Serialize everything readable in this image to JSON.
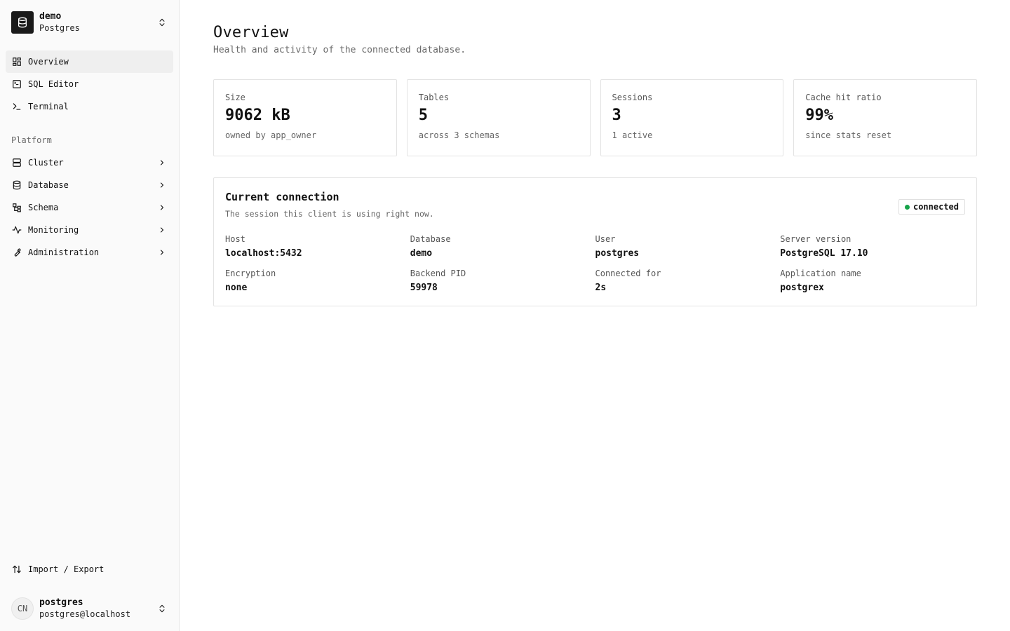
{
  "sidebar": {
    "db_name": "demo",
    "db_type": "Postgres",
    "nav_primary": [
      {
        "label": "Overview",
        "icon": "layout-grid-icon",
        "active": true
      },
      {
        "label": "SQL Editor",
        "icon": "square-terminal-icon"
      },
      {
        "label": "Terminal",
        "icon": "terminal-prompt-icon"
      }
    ],
    "section_label": "Platform",
    "nav_platform": [
      {
        "label": "Cluster",
        "icon": "server-icon"
      },
      {
        "label": "Database",
        "icon": "database-icon"
      },
      {
        "label": "Schema",
        "icon": "schema-tree-icon"
      },
      {
        "label": "Monitoring",
        "icon": "activity-icon"
      },
      {
        "label": "Administration",
        "icon": "wrench-icon"
      }
    ],
    "import_export": "Import / Export",
    "user": {
      "initials": "CN",
      "name": "postgres",
      "email": "postgres@localhost"
    }
  },
  "main": {
    "title": "Overview",
    "subtitle": "Health and activity of the connected database.",
    "stats": [
      {
        "label": "Size",
        "value": "9062 kB",
        "sub": "owned by app_owner"
      },
      {
        "label": "Tables",
        "value": "5",
        "sub": "across 3 schemas"
      },
      {
        "label": "Sessions",
        "value": "3",
        "sub": "1 active"
      },
      {
        "label": "Cache hit ratio",
        "value": "99%",
        "sub": "since stats reset"
      }
    ],
    "connection": {
      "title": "Current connection",
      "subtitle": "The session this client is using right now.",
      "status": "connected",
      "status_color": "#16a34a",
      "fields": [
        {
          "label": "Host",
          "value": "localhost:5432"
        },
        {
          "label": "Database",
          "value": "demo"
        },
        {
          "label": "User",
          "value": "postgres"
        },
        {
          "label": "Server version",
          "value": "PostgreSQL 17.10"
        },
        {
          "label": "Encryption",
          "value": "none"
        },
        {
          "label": "Backend PID",
          "value": "59978"
        },
        {
          "label": "Connected for",
          "value": "2s"
        },
        {
          "label": "Application name",
          "value": "postgrex"
        }
      ]
    }
  }
}
